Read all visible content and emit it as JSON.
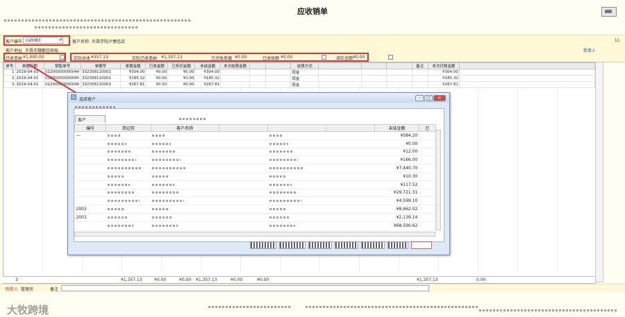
{
  "window": {
    "title": "应收销单"
  },
  "header": {
    "customer_code_label": "客户编号",
    "customer_code_value": "cs0083",
    "customer_name_label": "客户名称",
    "customer_name_value": "许昌学院卢豫信店",
    "customer_address_label": "客户地址",
    "customer_address_value": "许昌市魏都区邮局",
    "right_link": "检单人",
    "page_number": "11"
  },
  "summary": {
    "receivable_label": "已收单纳",
    "receivable_value": "¥1,000.00",
    "actual_total_label": "实际总收",
    "actual_total_value": "¥357.13",
    "actual_paid_label": "实际已收单纳",
    "actual_paid_value": "¥1,357.13",
    "pending_label": "已付账单据",
    "pending_value": "¥0.00",
    "cleared_label": "已收账额",
    "cleared_value": "¥0.00",
    "adjust_label": "调实金额",
    "adjust_value": "¥0.00"
  },
  "grid": {
    "columns": [
      "单号",
      "单据日期",
      "销售单号",
      "单据号",
      "单据金额",
      "已收金额",
      "已折扣金额",
      "未结金额",
      "本次结算金额",
      "",
      "",
      "结算方式",
      "",
      "",
      "",
      "备注",
      "本次付款金额"
    ],
    "rows": [
      {
        "no": "1",
        "date": "2019-04-01",
        "sale": "01200000000044",
        "doc": "332308110001",
        "amount": "¥304.00",
        "paid": "¥0.00",
        "disc": "¥0.00",
        "rest": "¥304.00",
        "method": "现金",
        "pay": "¥304.00"
      },
      {
        "no": "2",
        "date": "2019-04-01",
        "sale": "01200000000045",
        "doc": "332308110002",
        "amount": "¥185.32",
        "paid": "¥0.00",
        "disc": "¥0.00",
        "rest": "¥185.32",
        "method": "现金",
        "pay": "¥185.32"
      },
      {
        "no": "3",
        "date": "2019-04-01",
        "sale": "01200000000046",
        "doc": "332308110003",
        "amount": "¥267.81",
        "paid": "¥0.00",
        "disc": "¥0.00",
        "rest": "¥267.81",
        "method": "现金",
        "pay": "¥267.81"
      }
    ],
    "totals": {
      "count": "3",
      "amount": "¥1,357.13",
      "paid": "¥0.00",
      "disc": "¥0.00",
      "rest": "¥1,357.13",
      "settle": "¥0.00",
      "extra": "¥0.00",
      "pay": "¥1,357.13",
      "tail": "0.00"
    }
  },
  "footer": {
    "maker_label": "制单人",
    "maker_value": "管理员",
    "note_label": "备注"
  },
  "watermark": "大牧跨境",
  "dialog": {
    "title": "选择客户",
    "tab": "客户",
    "columns": [
      "编号",
      "简记符",
      "客户名称",
      "",
      "",
      "",
      "未结金额",
      "已"
    ],
    "rows": [
      {
        "code": "—",
        "amount": "¥584.20"
      },
      {
        "code": "",
        "amount": "¥0.00"
      },
      {
        "code": "",
        "amount": "¥12.00"
      },
      {
        "code": "",
        "amount": "¥166.00"
      },
      {
        "code": "",
        "amount": "¥7,440.70"
      },
      {
        "code": "",
        "amount": "¥10.30"
      },
      {
        "code": "",
        "amount": "¥117.52"
      },
      {
        "code": "",
        "amount": "¥29,721.31"
      },
      {
        "code": "",
        "amount": "¥4,599.10"
      },
      {
        "code": "2002",
        "amount": "¥8,662.02"
      },
      {
        "code": "2001",
        "amount": "¥2,139.14"
      },
      {
        "code": "",
        "amount": "¥68,590.62"
      }
    ]
  },
  "colors": {
    "highlight": "#e0323a",
    "bg": "#fffef2"
  }
}
